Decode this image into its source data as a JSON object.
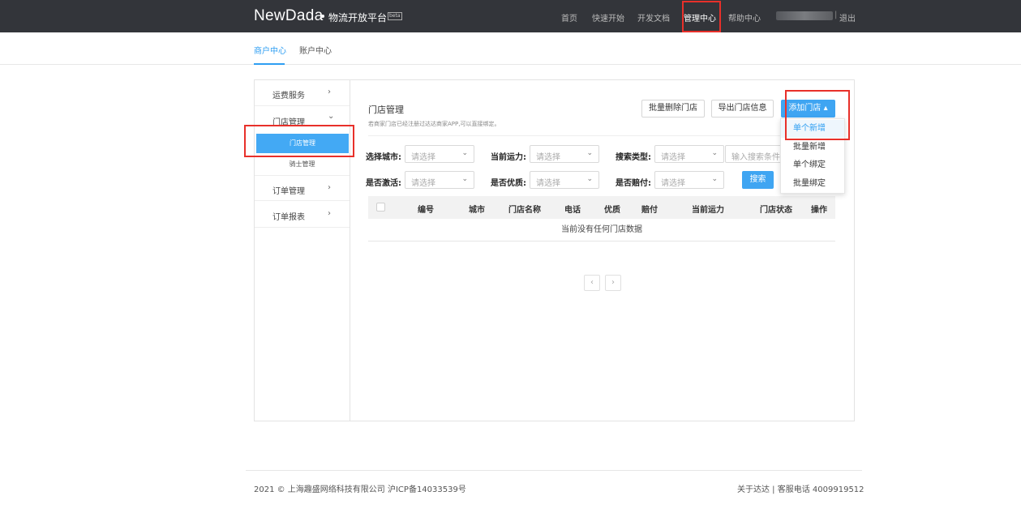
{
  "header": {
    "brand": "NewDada",
    "subtitle": "物流开放平台",
    "badge": "beta",
    "nav": [
      "首页",
      "快速开始",
      "开发文档",
      "管理中心",
      "帮助中心"
    ],
    "logout": "退出"
  },
  "subtabs": [
    "商户中心",
    "账户中心"
  ],
  "sidebar": {
    "items": [
      {
        "label": "运费服务",
        "arrow": "›"
      },
      {
        "label": "门店管理",
        "arrow": "⌄"
      },
      {
        "label": "订单管理",
        "arrow": "›"
      },
      {
        "label": "订单报表",
        "arrow": "›"
      }
    ],
    "sub": [
      "门店管理",
      "骑士管理"
    ]
  },
  "main": {
    "title": "门店管理",
    "hint": "若商家门店已经注册过达达商家APP,可以直接绑定。",
    "buttons": {
      "batch_delete": "批量删除门店",
      "export": "导出门店信息",
      "add": "添加门店 ▴"
    },
    "filters": {
      "city_label": "选择城市:",
      "capacity_label": "当前运力:",
      "search_type_label": "搜索类型:",
      "active_label": "是否激活:",
      "quality_label": "是否优质:",
      "compensation_label": "是否赔付:",
      "select_placeholder": "请选择",
      "search_placeholder": "输入搜索条件",
      "search_button": "搜索"
    },
    "table": {
      "headers": [
        "编号",
        "城市",
        "门店名称",
        "电话",
        "优质",
        "赔付",
        "当前运力",
        "门店状态",
        "操作"
      ],
      "empty": "当前没有任何门店数据"
    },
    "pager": {
      "prev": "‹",
      "next": "›"
    }
  },
  "dropdown": [
    "单个新增",
    "批量新增",
    "单个绑定",
    "批量绑定"
  ],
  "footer": {
    "left": "2021 © 上海趣盛网络科技有限公司 沪ICP备14033539号",
    "right": "关于达达 | 客服电话 4009919512"
  }
}
